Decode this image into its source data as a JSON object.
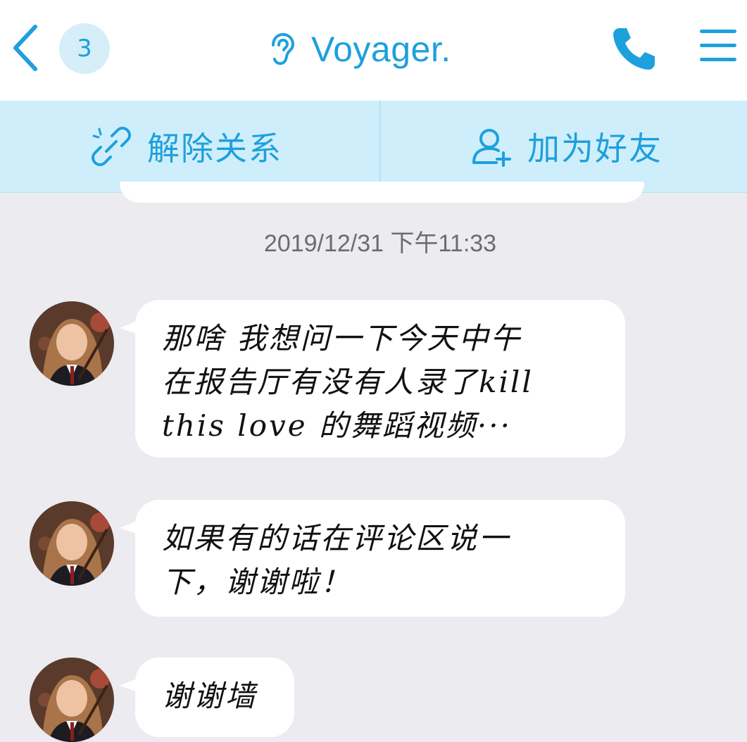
{
  "header": {
    "unread_count": "3",
    "title": "Voyager.",
    "icons": {
      "back": "chevron-left-icon",
      "listen": "ear-icon",
      "call": "phone-icon",
      "menu": "hamburger-menu-icon"
    }
  },
  "actions": [
    {
      "label": "解除关系",
      "icon": "broken-link-icon"
    },
    {
      "label": "加为好友",
      "icon": "add-friend-icon"
    }
  ],
  "timestamp": "2019/12/31 下午11:33",
  "messages": [
    {
      "text": "那啥 我想问一下今天中午\n在报告厅有没有人录了kill\nthis love 的舞蹈视频···"
    },
    {
      "text": "如果有的话在评论区说一\n下，谢谢啦！"
    },
    {
      "text": "谢谢墙"
    }
  ],
  "colors": {
    "accent": "#1ea0dc",
    "header_bg": "#ffffff",
    "action_bar_bg": "#cfeefb",
    "chat_bg": "#ebebf0",
    "bubble_bg": "#ffffff"
  }
}
